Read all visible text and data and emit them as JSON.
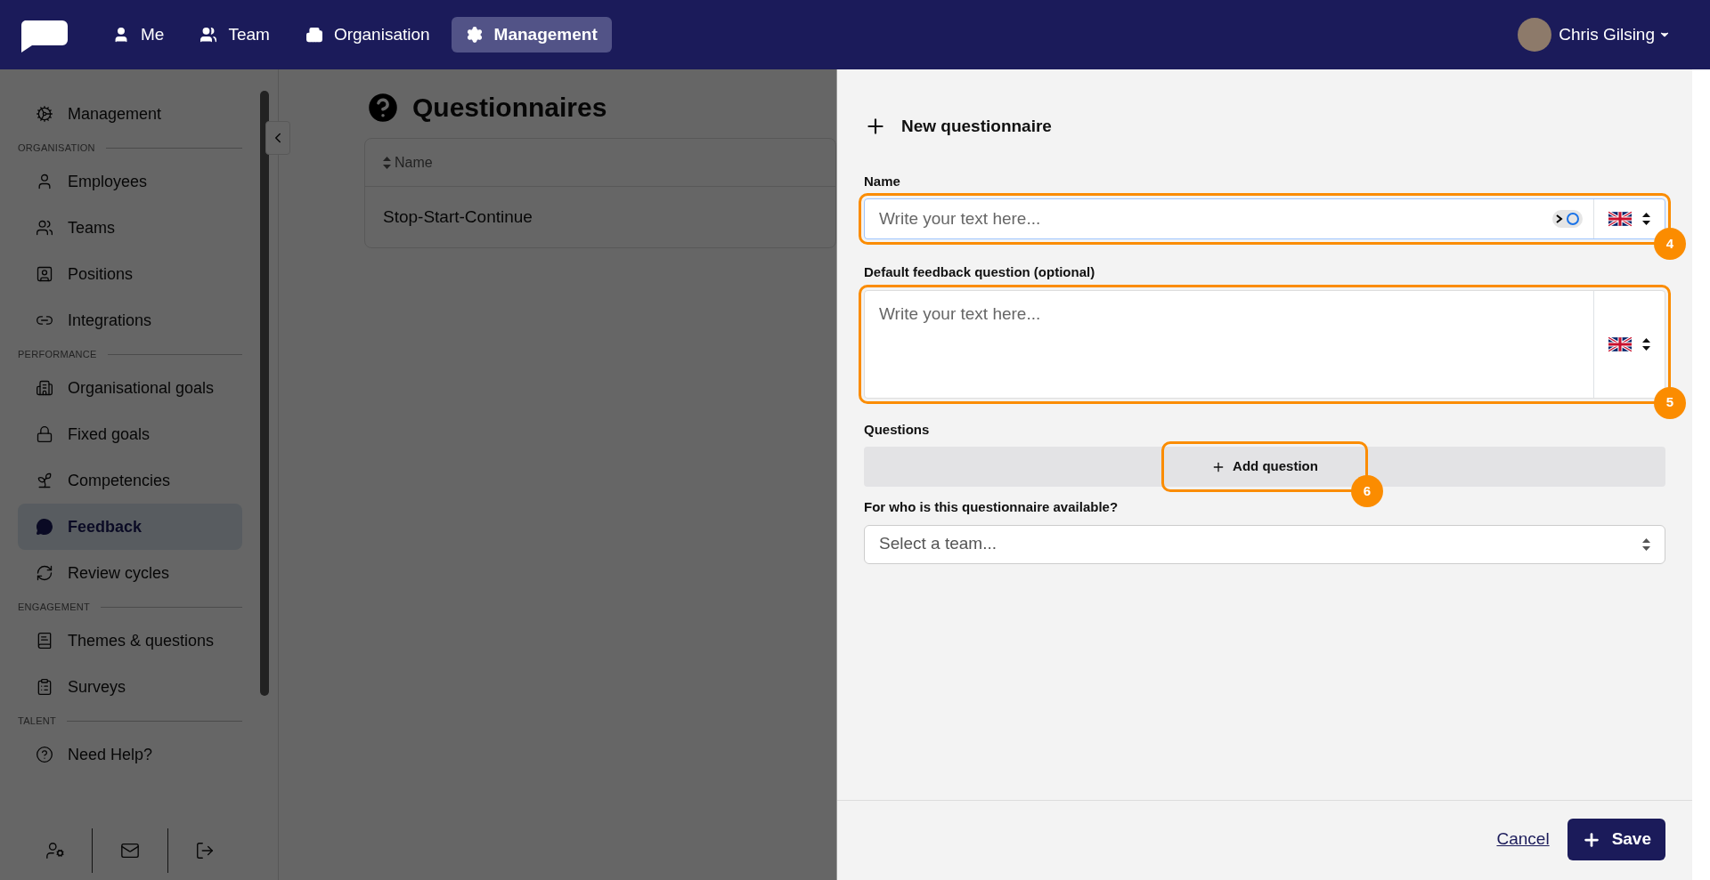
{
  "nav": {
    "items": [
      {
        "label": "Me",
        "selected": false
      },
      {
        "label": "Team",
        "selected": false
      },
      {
        "label": "Organisation",
        "selected": false
      },
      {
        "label": "Management",
        "selected": true
      }
    ],
    "user": "Chris Gilsing"
  },
  "sidebar": {
    "sections": [
      {
        "items": [
          {
            "label": "Management",
            "selected": false
          }
        ]
      },
      {
        "heading": "ORGANISATION",
        "items": [
          {
            "label": "Employees",
            "selected": false
          },
          {
            "label": "Teams",
            "selected": false
          },
          {
            "label": "Positions",
            "selected": false
          },
          {
            "label": "Integrations",
            "selected": false
          }
        ]
      },
      {
        "heading": "PERFORMANCE",
        "items": [
          {
            "label": "Organisational goals",
            "selected": false
          },
          {
            "label": "Fixed goals",
            "selected": false
          },
          {
            "label": "Competencies",
            "selected": false
          },
          {
            "label": "Feedback",
            "selected": true
          },
          {
            "label": "Review cycles",
            "selected": false
          }
        ]
      },
      {
        "heading": "ENGAGEMENT",
        "items": [
          {
            "label": "Themes & questions",
            "selected": false
          },
          {
            "label": "Surveys",
            "selected": false
          }
        ]
      },
      {
        "heading": "TALENT",
        "items": [
          {
            "label": "Need Help?",
            "selected": false
          }
        ]
      }
    ]
  },
  "main": {
    "title": "Questionnaires",
    "columns": [
      "Name"
    ],
    "rows": [
      "Stop-Start-Continue"
    ]
  },
  "drawer": {
    "title": "New questionnaire",
    "fields": [
      {
        "kind": "text",
        "label": "Name",
        "placeholder": "Write your text here...",
        "callout": "4"
      },
      {
        "kind": "textarea",
        "label": "Default feedback question (optional)",
        "placeholder": "Write your text here...",
        "callout": "5"
      },
      {
        "kind": "questions",
        "label": "Questions",
        "button": "Add question",
        "callout": "6"
      },
      {
        "kind": "select",
        "label": "For who is this questionnaire available?",
        "placeholder": "Select a team..."
      }
    ],
    "cancel": "Cancel",
    "save": "Save"
  }
}
